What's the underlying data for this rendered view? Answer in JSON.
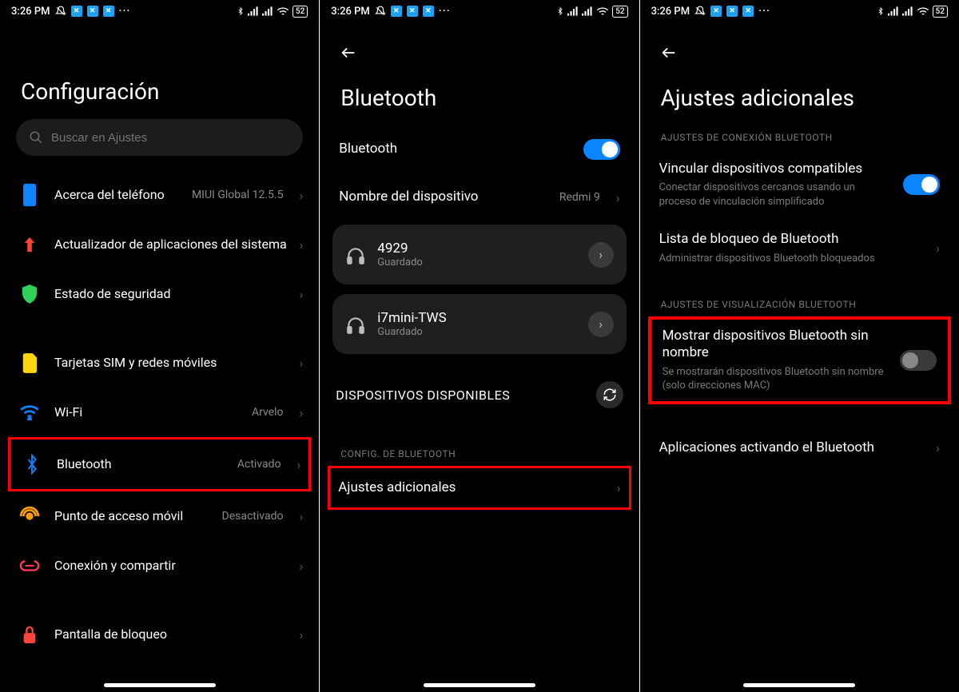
{
  "statusbar": {
    "time": "3:26 PM",
    "battery": "52"
  },
  "screen1": {
    "title": "Configuración",
    "search_placeholder": "Buscar en Ajustes",
    "items": {
      "about": {
        "label": "Acerca del teléfono",
        "value": "MIUI Global 12.5.5"
      },
      "updater": {
        "label": "Actualizador de aplicaciones del sistema"
      },
      "security": {
        "label": "Estado de seguridad"
      },
      "sim": {
        "label": "Tarjetas SIM y redes móviles"
      },
      "wifi": {
        "label": "Wi-Fi",
        "value": "Arvelo"
      },
      "bt": {
        "label": "Bluetooth",
        "value": "Activado"
      },
      "hotspot": {
        "label": "Punto de acceso móvil",
        "value": "Desactivado"
      },
      "share": {
        "label": "Conexión y compartir"
      },
      "lock": {
        "label": "Pantalla de bloqueo"
      }
    }
  },
  "screen2": {
    "title": "Bluetooth",
    "toggle_label": "Bluetooth",
    "device_name_label": "Nombre del dispositivo",
    "device_name_value": "Redmi 9",
    "devices": [
      {
        "name": "4929",
        "status": "Guardado"
      },
      {
        "name": "i7mini-TWS",
        "status": "Guardado"
      }
    ],
    "available_label": "DISPOSITIVOS DISPONIBLES",
    "config_header": "CONFIG. DE BLUETOOTH",
    "additional_label": "Ajustes adicionales"
  },
  "screen3": {
    "title": "Ajustes adicionales",
    "conn_header": "AJUSTES DE CONEXIÓN BLUETOOTH",
    "pair": {
      "title": "Vincular dispositivos compatibles",
      "desc": "Conectar dispositivos cercanos usando un proceso de vinculación simplificado"
    },
    "blocklist": {
      "title": "Lista de bloqueo de Bluetooth",
      "desc": "Administrar dispositivos Bluetooth bloqueados"
    },
    "view_header": "AJUSTES DE VISUALIZACIÓN BLUETOOTH",
    "noname": {
      "title": "Mostrar dispositivos Bluetooth sin nombre",
      "desc": "Se mostrarán dispositivos Bluetooth sin nombre (solo direcciones MAC)"
    },
    "apps": {
      "title": "Aplicaciones activando el Bluetooth"
    }
  }
}
